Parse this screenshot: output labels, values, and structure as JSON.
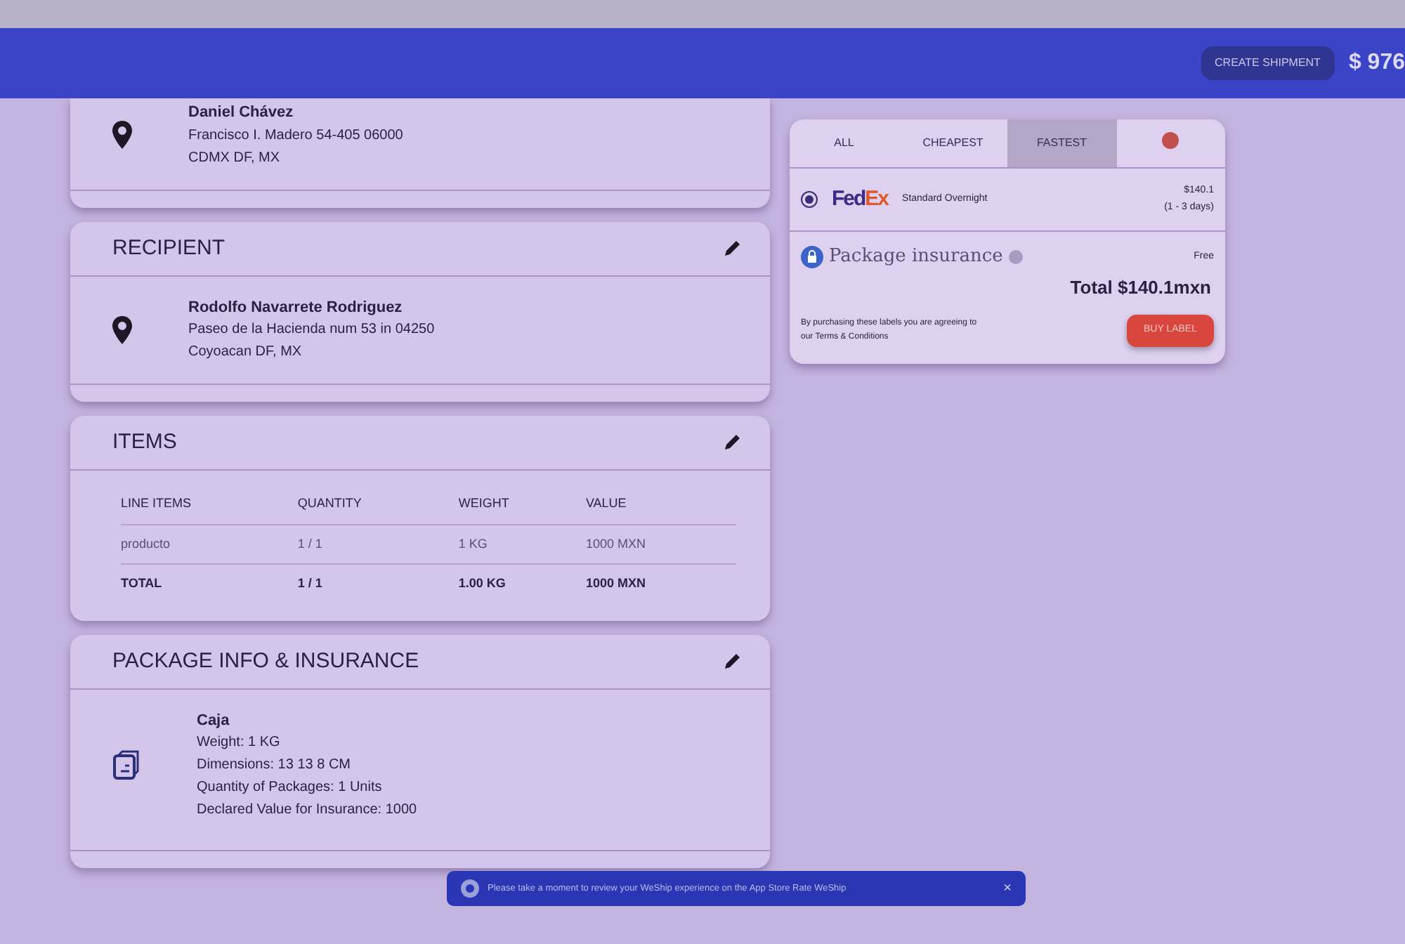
{
  "navbar": {
    "create_button": "CREATE SHIPMENT",
    "balance": "$ 976"
  },
  "sender": {
    "name": "Daniel Chávez",
    "address_lines": [
      "Francisco I. Madero 54-405 06000",
      "CDMX DF, MX"
    ]
  },
  "recipient": {
    "title": "RECIPIENT",
    "name": "Rodolfo Navarrete Rodriguez",
    "address_lines": [
      "Paseo de la Hacienda num 53 in 04250",
      "Coyoacan DF, MX"
    ]
  },
  "items": {
    "title": "ITEMS",
    "columns": [
      "LINE ITEMS",
      "QUANTITY",
      "WEIGHT",
      "VALUE"
    ],
    "rows": [
      {
        "kind": "item",
        "cells": [
          "producto",
          "1 / 1",
          "1 KG",
          "1000 MXN"
        ]
      },
      {
        "kind": "total",
        "cells": [
          "TOTAL",
          "1 / 1",
          "1.00 KG",
          "1000 MXN"
        ]
      }
    ]
  },
  "package": {
    "title": "PACKAGE INFO & INSURANCE",
    "name": "Caja",
    "lines": [
      "Weight: 1 KG",
      "Dimensions: 13 13 8 CM",
      "Quantity of Packages: 1 Units",
      "Declared Value for Insurance: 1000"
    ]
  },
  "rates": {
    "tabs": [
      {
        "kind": "text",
        "label": "ALL",
        "selected": false
      },
      {
        "kind": "text",
        "label": "CHEAPEST",
        "selected": false
      },
      {
        "kind": "text",
        "label": "FASTEST",
        "selected": true
      },
      {
        "kind": "dot",
        "selected": false
      }
    ],
    "options": [
      {
        "logo_parts": [
          "Fed",
          "Ex"
        ],
        "service": "Standard Overnight",
        "price": "$140.1",
        "days": "(1 - 3 days)",
        "selected": true
      }
    ],
    "insurance_label": "Package insurance",
    "insurance_price": "Free",
    "total": "Total $140.1mxn",
    "terms_text": "By purchasing these labels you are agreeing to our",
    "terms_link": "Terms & Conditions",
    "buy_button": "BUY LABEL"
  },
  "toast": {
    "text": "Please take a moment to review your WeShip experience on the App Store",
    "link": "Rate WeShip",
    "close": "×"
  }
}
